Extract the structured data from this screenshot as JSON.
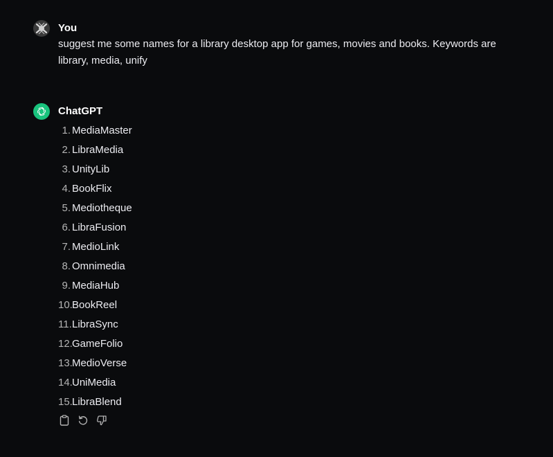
{
  "conversation": {
    "user": {
      "author": "You",
      "text": "suggest me some names for a library desktop app for games, movies and books. Keywords are library, media, unify"
    },
    "assistant": {
      "author": "ChatGPT",
      "items": [
        {
          "num": "1.",
          "name": "MediaMaster"
        },
        {
          "num": "2.",
          "name": "LibraMedia"
        },
        {
          "num": "3.",
          "name": "UnityLib"
        },
        {
          "num": "4.",
          "name": "BookFlix"
        },
        {
          "num": "5.",
          "name": "Mediotheque"
        },
        {
          "num": "6.",
          "name": "LibraFusion"
        },
        {
          "num": "7.",
          "name": "MedioLink"
        },
        {
          "num": "8.",
          "name": "Omnimedia"
        },
        {
          "num": "9.",
          "name": "MediaHub"
        },
        {
          "num": "10.",
          "name": "BookReel"
        },
        {
          "num": "11.",
          "name": "LibraSync"
        },
        {
          "num": "12.",
          "name": "GameFolio"
        },
        {
          "num": "13.",
          "name": "MedioVerse"
        },
        {
          "num": "14.",
          "name": "UniMedia"
        },
        {
          "num": "15.",
          "name": "LibraBlend"
        }
      ]
    }
  },
  "actions": {
    "icons": [
      "clipboard-icon",
      "regenerate-icon",
      "thumbs-down-icon"
    ]
  },
  "colors": {
    "background": "#0a0b0d",
    "text": "#ececf1",
    "gpt_avatar": "#19c37d"
  }
}
